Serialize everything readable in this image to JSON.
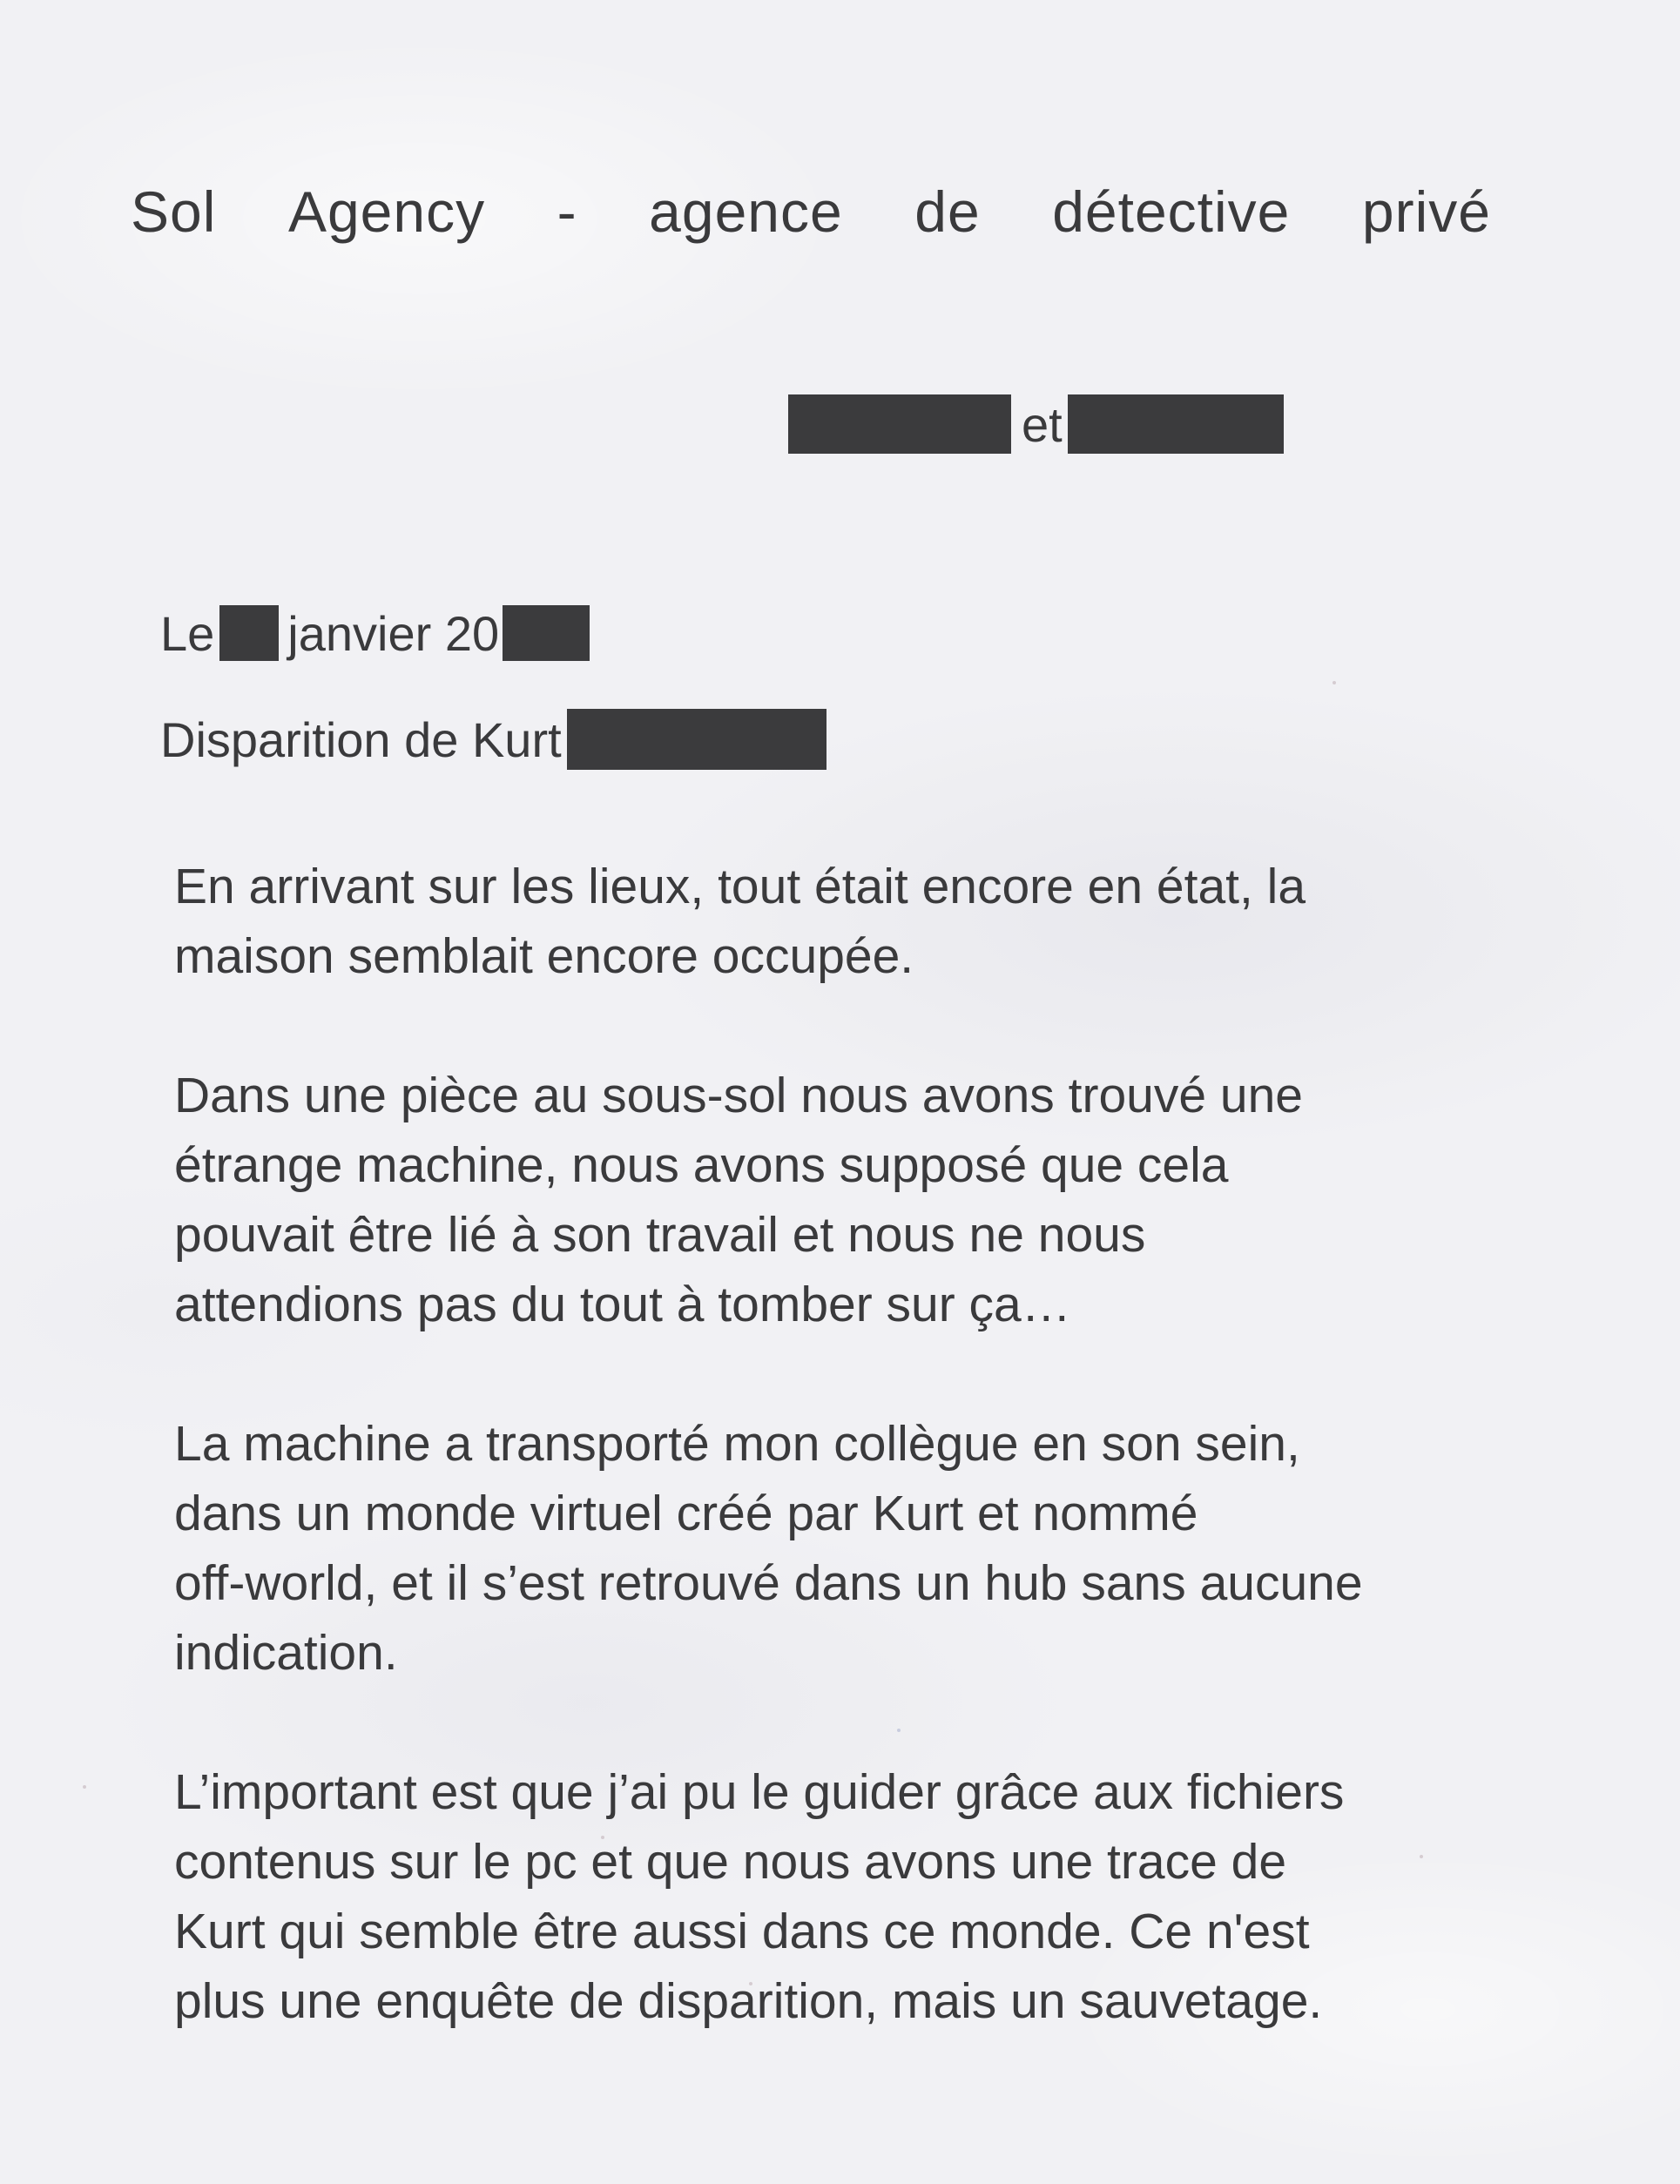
{
  "document": {
    "header": {
      "words": [
        "Sol",
        "Agency",
        "-",
        "agence",
        "de",
        "détective",
        "privé"
      ]
    },
    "recipients": {
      "conjunction": "et"
    },
    "date": {
      "prefix": "Le",
      "month": "janvier 20"
    },
    "subject": {
      "text": "Disparition de Kurt"
    },
    "paragraphs": [
      "En arrivant sur les lieux, tout était encore en état, la\nmaison semblait encore occupée.",
      "Dans une pièce au sous-sol nous avons trouvé une\nétrange machine,  nous avons supposé que cela\npouvait être lié à son travail et nous ne nous\nattendions pas du tout à tomber sur ça…",
      "La machine a transporté mon collègue en son sein,\ndans un monde virtuel créé par Kurt et nommé\noff-world, et il s’est retrouvé dans un hub sans aucune\nindication.",
      "L’important est que j’ai pu le guider grâce aux fichiers\ncontenus sur le pc et que nous avons une trace de\nKurt qui semble être aussi dans ce monde. Ce n'est\nplus une enquête de disparition, mais un sauvetage."
    ]
  },
  "colors": {
    "paper": "#f1f1f4",
    "ink": "#3a3a3c",
    "redaction": "#3b3b3d"
  }
}
